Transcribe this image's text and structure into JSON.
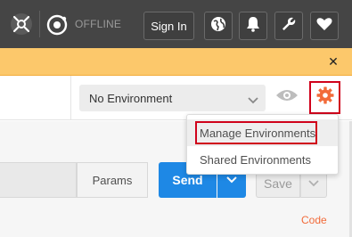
{
  "topbar": {
    "status": "OFFLINE",
    "sign_in_label": "Sign In",
    "icons": [
      "capture-icon",
      "sync-icon",
      "globe-icon",
      "bell-icon",
      "wrench-icon",
      "heart-icon"
    ]
  },
  "banner": {
    "close_glyph": "✕"
  },
  "environment": {
    "selected": "No Environment"
  },
  "env_menu": {
    "items": [
      "Manage Environments",
      "Shared Environments"
    ]
  },
  "request": {
    "params_label": "Params",
    "send_label": "Send",
    "save_label": "Save",
    "code_label": "Code"
  },
  "colors": {
    "topbar": "#454545",
    "banner": "#fcc86b",
    "accent_orange": "#f26b3a",
    "send_blue": "#1e88e5",
    "highlight_red": "#d0021b"
  }
}
